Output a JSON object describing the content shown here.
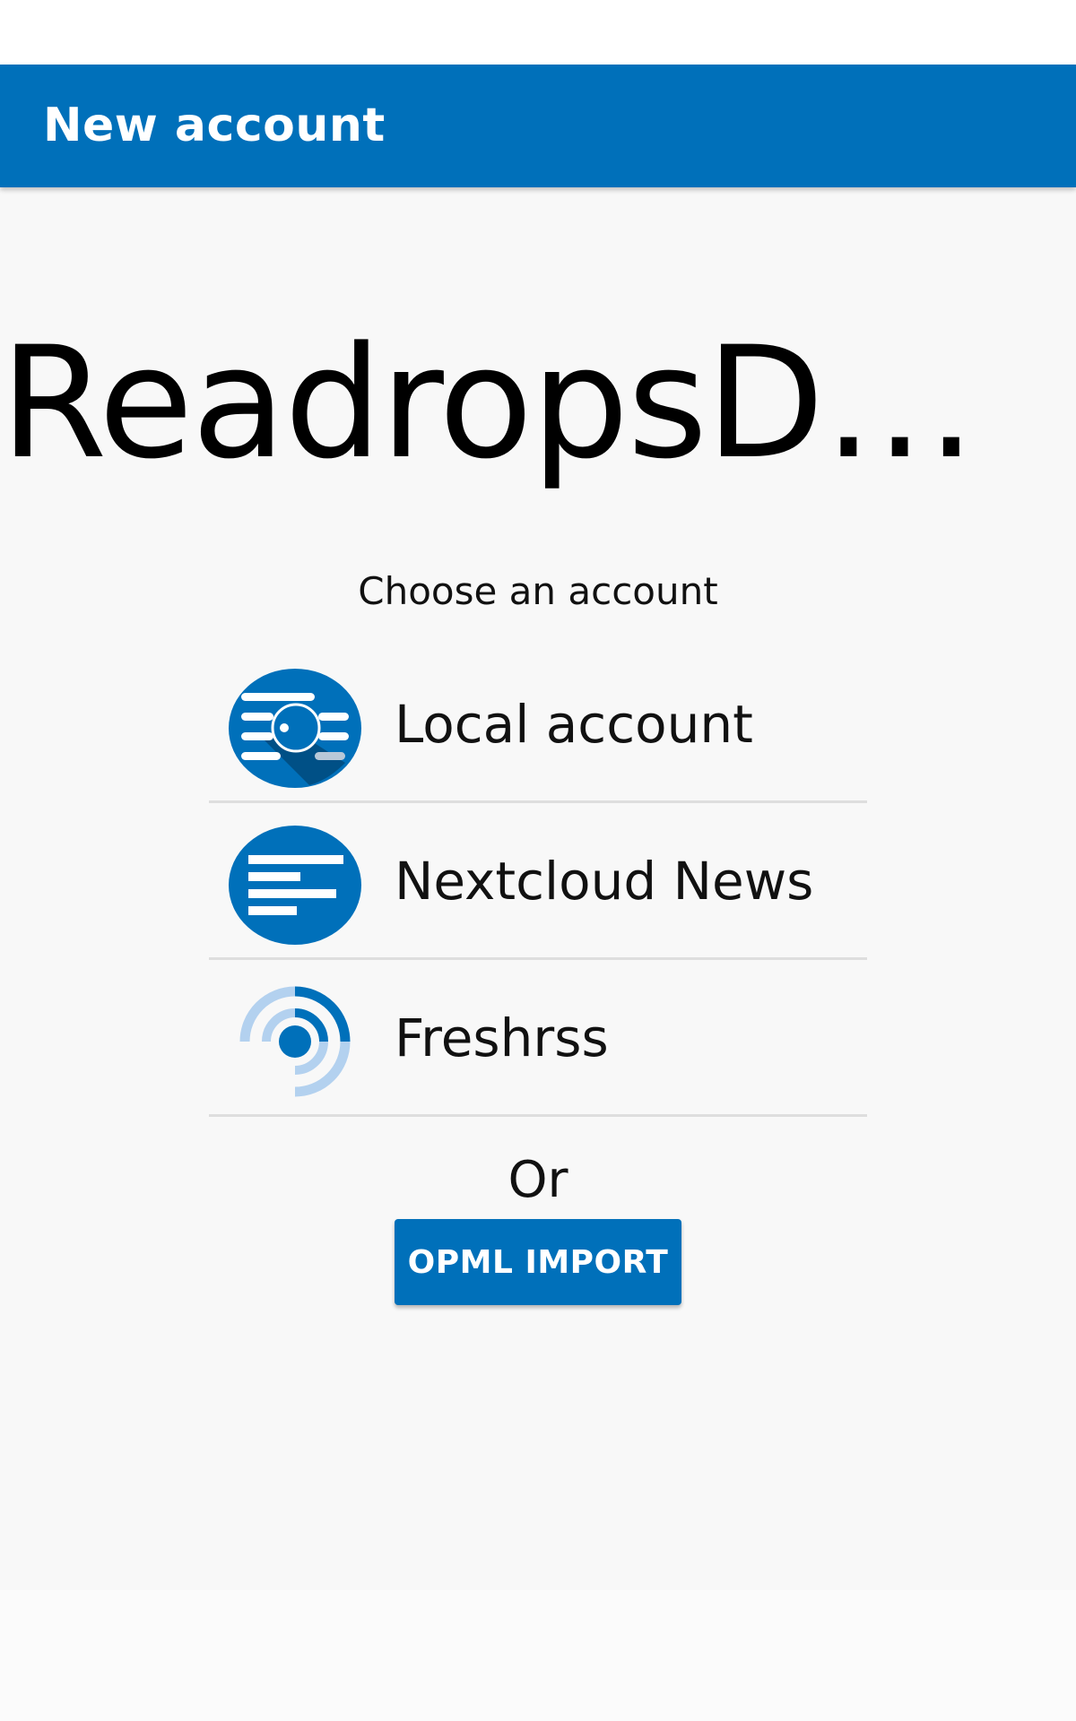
{
  "colors": {
    "primary": "#0070ba",
    "background": "#f8f8f8",
    "divider": "#dedede",
    "text": "#111111",
    "freshrss_light": "#b3d1ef"
  },
  "app_bar": {
    "title": "New account"
  },
  "main": {
    "app_name": "ReadropsDebug",
    "choose_label": "Choose an account",
    "accounts": [
      {
        "label": "Local account",
        "icon": "local-account-icon"
      },
      {
        "label": "Nextcloud News",
        "icon": "nextcloud-news-icon"
      },
      {
        "label": "Freshrss",
        "icon": "freshrss-icon"
      }
    ],
    "or_label": "Or",
    "opml_button": "OPML IMPORT"
  }
}
